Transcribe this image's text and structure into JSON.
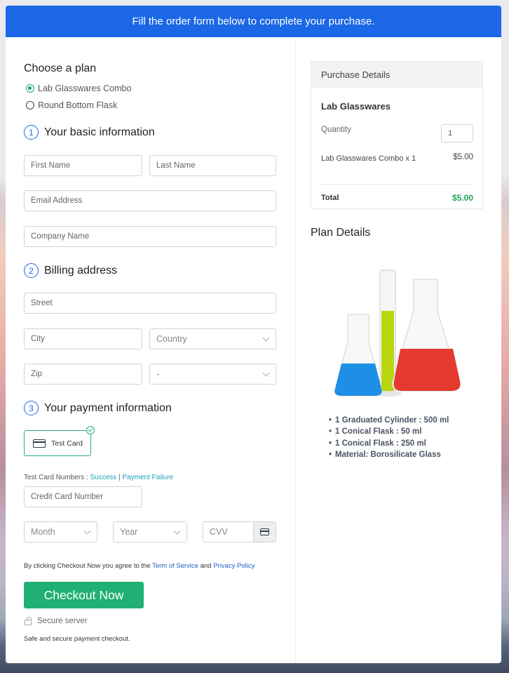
{
  "banner": {
    "text": "Fill the order form below to complete your purchase."
  },
  "plan": {
    "title": "Choose a plan",
    "options": [
      {
        "label": "Lab Glasswares Combo",
        "selected": true
      },
      {
        "label": "Round Bottom Flask",
        "selected": false
      }
    ]
  },
  "basic_info": {
    "number": "1",
    "title": "Your basic information",
    "first_name_placeholder": "First Name",
    "last_name_placeholder": "Last Name",
    "email_placeholder": "Email Address",
    "company_placeholder": "Company Name"
  },
  "billing": {
    "number": "2",
    "title": "Billing address",
    "street_placeholder": "Street",
    "city_placeholder": "City",
    "country_selected": "Country",
    "zip_placeholder": "Zip",
    "state_selected": "-"
  },
  "payment": {
    "number": "3",
    "title": "Your payment information",
    "method_label": "Test Card",
    "test_numbers_label": "Test Card Numbers : ",
    "success_link": "Success",
    "separator": " | ",
    "failure_link": "Payment Failure",
    "card_number_placeholder": "Credit Card Number",
    "month_selected": "Month",
    "year_selected": "Year",
    "cvv_placeholder": "CVV"
  },
  "terms": {
    "prefix": "By clicking Checkout Now you agree to the ",
    "tos_link": "Term of Service",
    "and": " and ",
    "privacy_link": "Privacy Policy"
  },
  "checkout": {
    "button_label": "Checkout Now",
    "secure_label": "Secure server",
    "safe_note": "Safe and secure payment checkout."
  },
  "purchase_details": {
    "header": "Purchase Details",
    "product": "Lab Glasswares",
    "quantity_label": "Quantity",
    "quantity_value": "1",
    "line_item_label": "Lab Glasswares Combo x 1",
    "line_item_price": "$5.00",
    "total_label": "Total",
    "total_value": "$5.00",
    "total_color": "#20a35a"
  },
  "plan_details": {
    "title": "Plan Details",
    "image_alt": "lab-glassware-photo",
    "features": [
      "1 Graduated Cylinder : 500 ml",
      "1 Conical Flask : 50 ml",
      "1 Conical Flask : 250 ml",
      "Material: Borosilicate Glass"
    ]
  }
}
